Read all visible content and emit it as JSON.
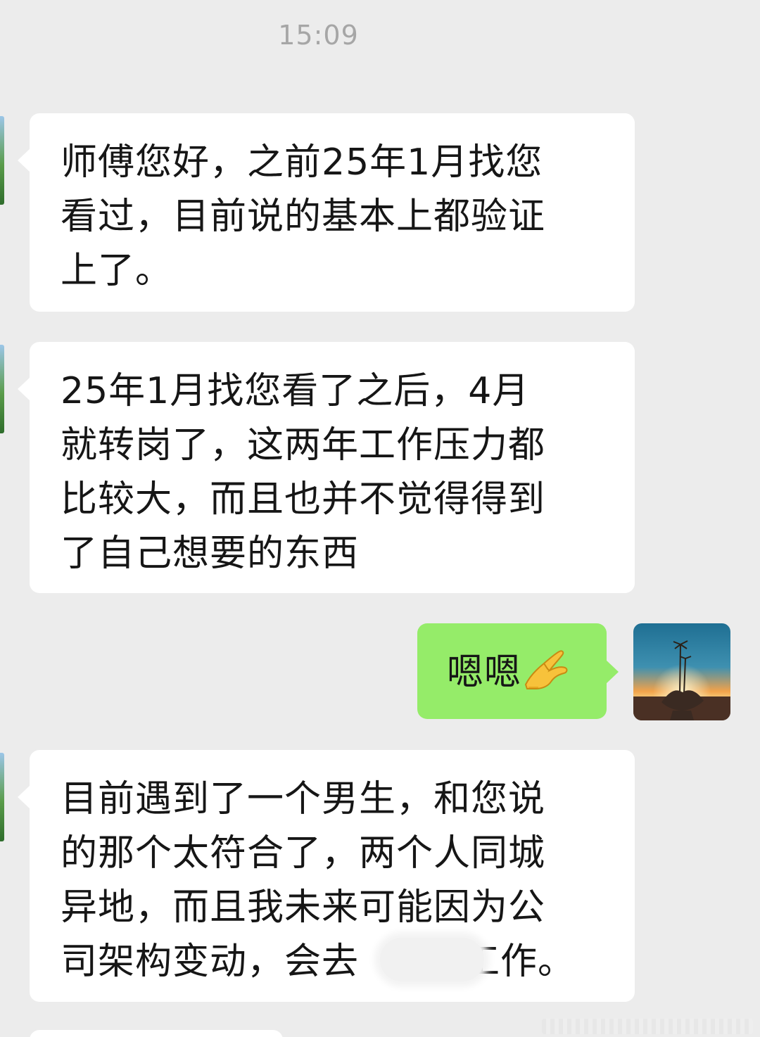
{
  "chat": {
    "timestamp": "15:09",
    "messages": [
      {
        "sender": "other",
        "lines": [
          "师傅您好，之前25年1月找您",
          "看过，目前说的基本上都验证",
          "上了。"
        ]
      },
      {
        "sender": "other",
        "lines": [
          "25年1月找您看了之后，4月",
          "就转岗了，这两年工作压力都",
          "比较大，而且也并不觉得得到",
          "了自己想要的东西"
        ]
      },
      {
        "sender": "self",
        "text": "嗯嗯",
        "emoji": "pinch-hand-emoji"
      },
      {
        "sender": "other",
        "lines": [
          "目前遇到了一个男生，和您说",
          "的那个太符合了，两个人同城",
          "异地，而且我未来可能因为公"
        ],
        "last_line_before": "司架构变动，会去",
        "last_line_after": "工作。"
      }
    ]
  },
  "colors": {
    "background": "#ececec",
    "incoming_bubble": "#ffffff",
    "outgoing_bubble": "#95ec69",
    "timestamp_text": "#a6a6a6",
    "message_text": "#161616"
  },
  "icons": {
    "self_avatar": "sunset-palm-hand-avatar",
    "redaction": "blurred-redaction"
  }
}
